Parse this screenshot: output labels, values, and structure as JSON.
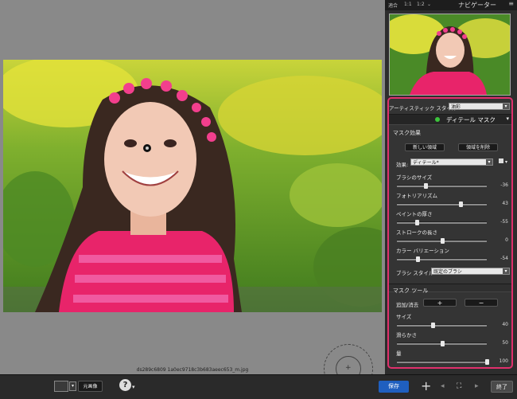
{
  "canvas": {
    "filename": "ds289c6809 1a0ec9718c3b683aeec653_m.jpg"
  },
  "navigator": {
    "zoom_fit": "適合",
    "zoom_1_1": "1:1",
    "zoom_1_2": "1:2",
    "title": "ナビゲーター"
  },
  "edit": {
    "artistic_style_label": "アーティスティック スタイル",
    "artistic_style_value": "油彩",
    "detail_mask_label": "ディテール マスク",
    "mask_effect_title": "マスク効果",
    "new_area_label": "新しい領域",
    "delete_area_label": "領域を削除",
    "effect_label": "効果:",
    "effect_value": "ディテール*",
    "sliders": [
      {
        "label": "ブラシのサイズ",
        "value": "-36",
        "level": 0.32
      },
      {
        "label": "フォトリアリズム",
        "value": "43",
        "level": 0.71
      },
      {
        "label": "ペイントの厚さ",
        "value": "-55",
        "level": 0.22
      },
      {
        "label": "ストロークの長さ",
        "value": "0",
        "level": 0.5
      },
      {
        "label": "カラー バリエーション",
        "value": "-54",
        "level": 0.23
      }
    ],
    "brush_style_label": "ブラシ スタイル",
    "brush_style_value": "既定のブラシ",
    "mask_tool_title": "マスク ツール",
    "add_remove_label": "追加/消去",
    "add_button": "+",
    "remove_button": "−",
    "tool_sliders": [
      {
        "label": "サイズ",
        "value": "40",
        "level": 0.4
      },
      {
        "label": "滑らかさ",
        "value": "50",
        "level": 0.5
      },
      {
        "label": "量",
        "value": "100",
        "level": 1.0
      }
    ]
  },
  "toolbar": {
    "original_label": "元画像",
    "help_icon": "?",
    "save_label": "保存",
    "done_label": "終了"
  },
  "colors": {
    "highlight_border": "#e0306c",
    "save_button": "#1f5fbf"
  }
}
